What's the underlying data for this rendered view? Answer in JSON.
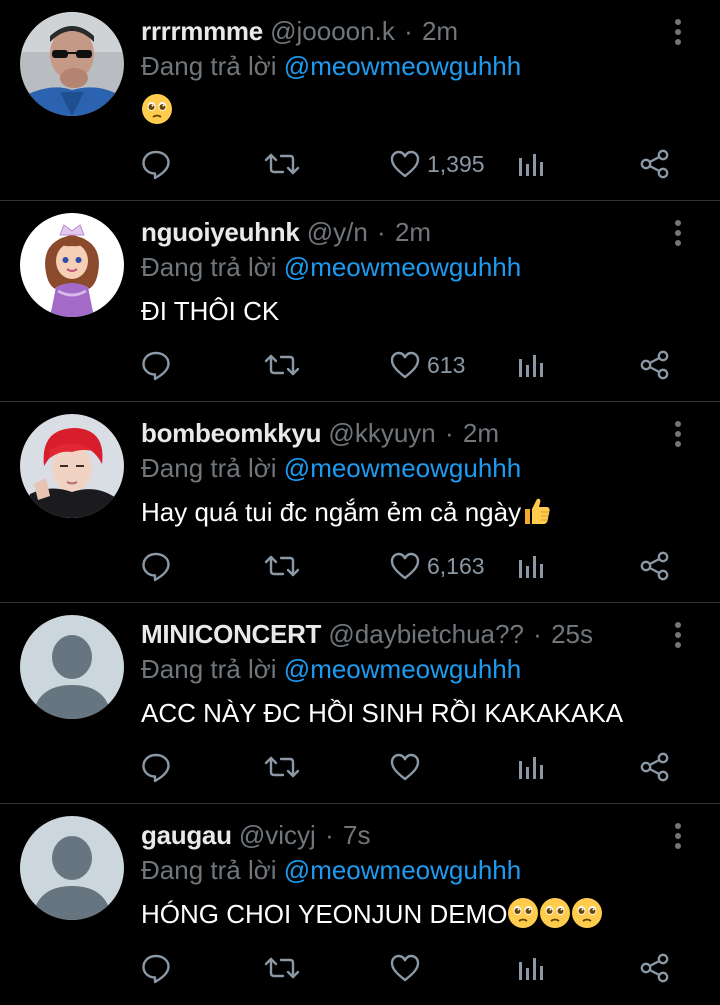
{
  "tweets": [
    {
      "name": "rrrrmmme",
      "handle": "@joooon.k",
      "separator": "·",
      "time": "2m",
      "reply_prefix": "Đang trả lời",
      "reply_to": "@meowmeowguhhh",
      "text": "",
      "emoji_count": 1,
      "likes": "1,395",
      "avatar": "photo-man-sunglasses"
    },
    {
      "name": "nguoiyeuhnk",
      "handle": "@y/n",
      "separator": "·",
      "time": "2m",
      "reply_prefix": "Đang trả lời",
      "reply_to": "@meowmeowguhhh",
      "text": "ĐI THÔI CK",
      "emoji_count": 0,
      "likes": "613",
      "avatar": "cartoon-princess"
    },
    {
      "name": "bombeomkkyu",
      "handle": "@kkyuyn",
      "separator": "·",
      "time": "2m",
      "reply_prefix": "Đang trả lời",
      "reply_to": "@meowmeowguhhh",
      "text": "Hay quá tui đc ngắm ẻm cả ngày",
      "emoji_count": 0,
      "thumbs_up": true,
      "likes": "6,163",
      "avatar": "photo-red-hair"
    },
    {
      "name": "MINICONCERT",
      "handle": "@daybietchua??",
      "separator": "·",
      "time": "25s",
      "reply_prefix": "Đang trả lời",
      "reply_to": "@meowmeowguhhh",
      "text": "ACC NÀY ĐC HỒI SINH RỒI KAKAKAKA",
      "emoji_count": 0,
      "likes": "",
      "avatar": "default-avatar"
    },
    {
      "name": "gaugau",
      "handle": "@vicyj",
      "separator": "·",
      "time": "7s",
      "reply_prefix": "Đang trả lời",
      "reply_to": "@meowmeowguhhh",
      "text": "HÓNG CHOI YEONJUN DEMO",
      "emoji_count": 3,
      "likes": "",
      "avatar": "default-avatar"
    }
  ],
  "colors": {
    "background": "#000000",
    "text": "#e7e9ea",
    "muted": "#71767b",
    "link": "#1d9bf0",
    "divider": "#2f3336",
    "icon": "#8b98a5"
  },
  "icons": [
    "reply-icon",
    "retweet-icon",
    "like-icon",
    "views-icon",
    "share-icon",
    "more-icon",
    "pleading-face-emoji",
    "thumbs-up-emoji"
  ]
}
